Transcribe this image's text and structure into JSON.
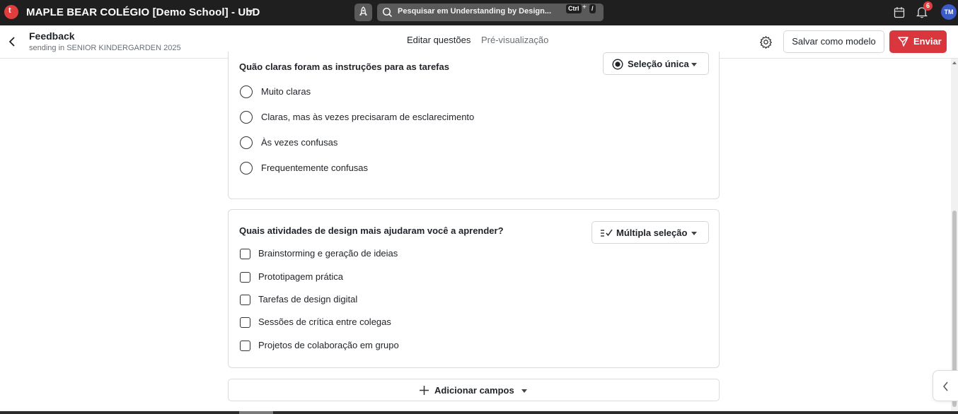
{
  "topbar": {
    "school_name": "MAPLE BEAR COLÉGIO [Demo School] - UbD",
    "search_placeholder": "Pesquisar em Understanding by Design...",
    "shortcut_key1": "Ctrl",
    "shortcut_plus": "+",
    "shortcut_key2": "/",
    "notification_count": "6",
    "avatar_initials": "TM",
    "icons": [
      "app-logo",
      "chevron-down-icon",
      "rocket-icon",
      "search-icon",
      "calendar-icon",
      "bell-icon"
    ]
  },
  "header": {
    "title": "Feedback",
    "subtitle": "sending in SENIOR KINDERGARDEN 2025",
    "tabs": [
      {
        "label": "Editar questões",
        "active": true
      },
      {
        "label": "Pré-visualização",
        "active": false
      }
    ],
    "save_template_label": "Salvar como modelo",
    "send_label": "Enviar",
    "icons": [
      "back-arrow-icon",
      "gear-icon",
      "send-icon"
    ]
  },
  "questions": [
    {
      "title": "Quão claras foram as instruções para as tarefas",
      "type_label": "Seleção única",
      "type_icon": "radio-selected-icon",
      "options": [
        "Muito claras",
        "Claras, mas às vezes precisaram de esclarecimento",
        "Às vezes confusas",
        "Frequentemente confusas"
      ]
    },
    {
      "title": "Quais atividades de design mais ajudaram você a aprender?",
      "type_label": "Múltipla seleção",
      "type_icon": "multi-select-icon",
      "options": [
        "Brainstorming e geração de ideias",
        "Prototipagem prática",
        "Tarefas de design digital",
        "Sessões de crítica entre colegas",
        "Projetos de colaboração em grupo"
      ]
    }
  ],
  "add_fields_label": "Adicionar campos",
  "colors": {
    "topbar_bg": "#1f1f1f",
    "accent_red": "#d9363e",
    "avatar_blue": "#3b5bc8",
    "border": "#dcdcdc"
  }
}
